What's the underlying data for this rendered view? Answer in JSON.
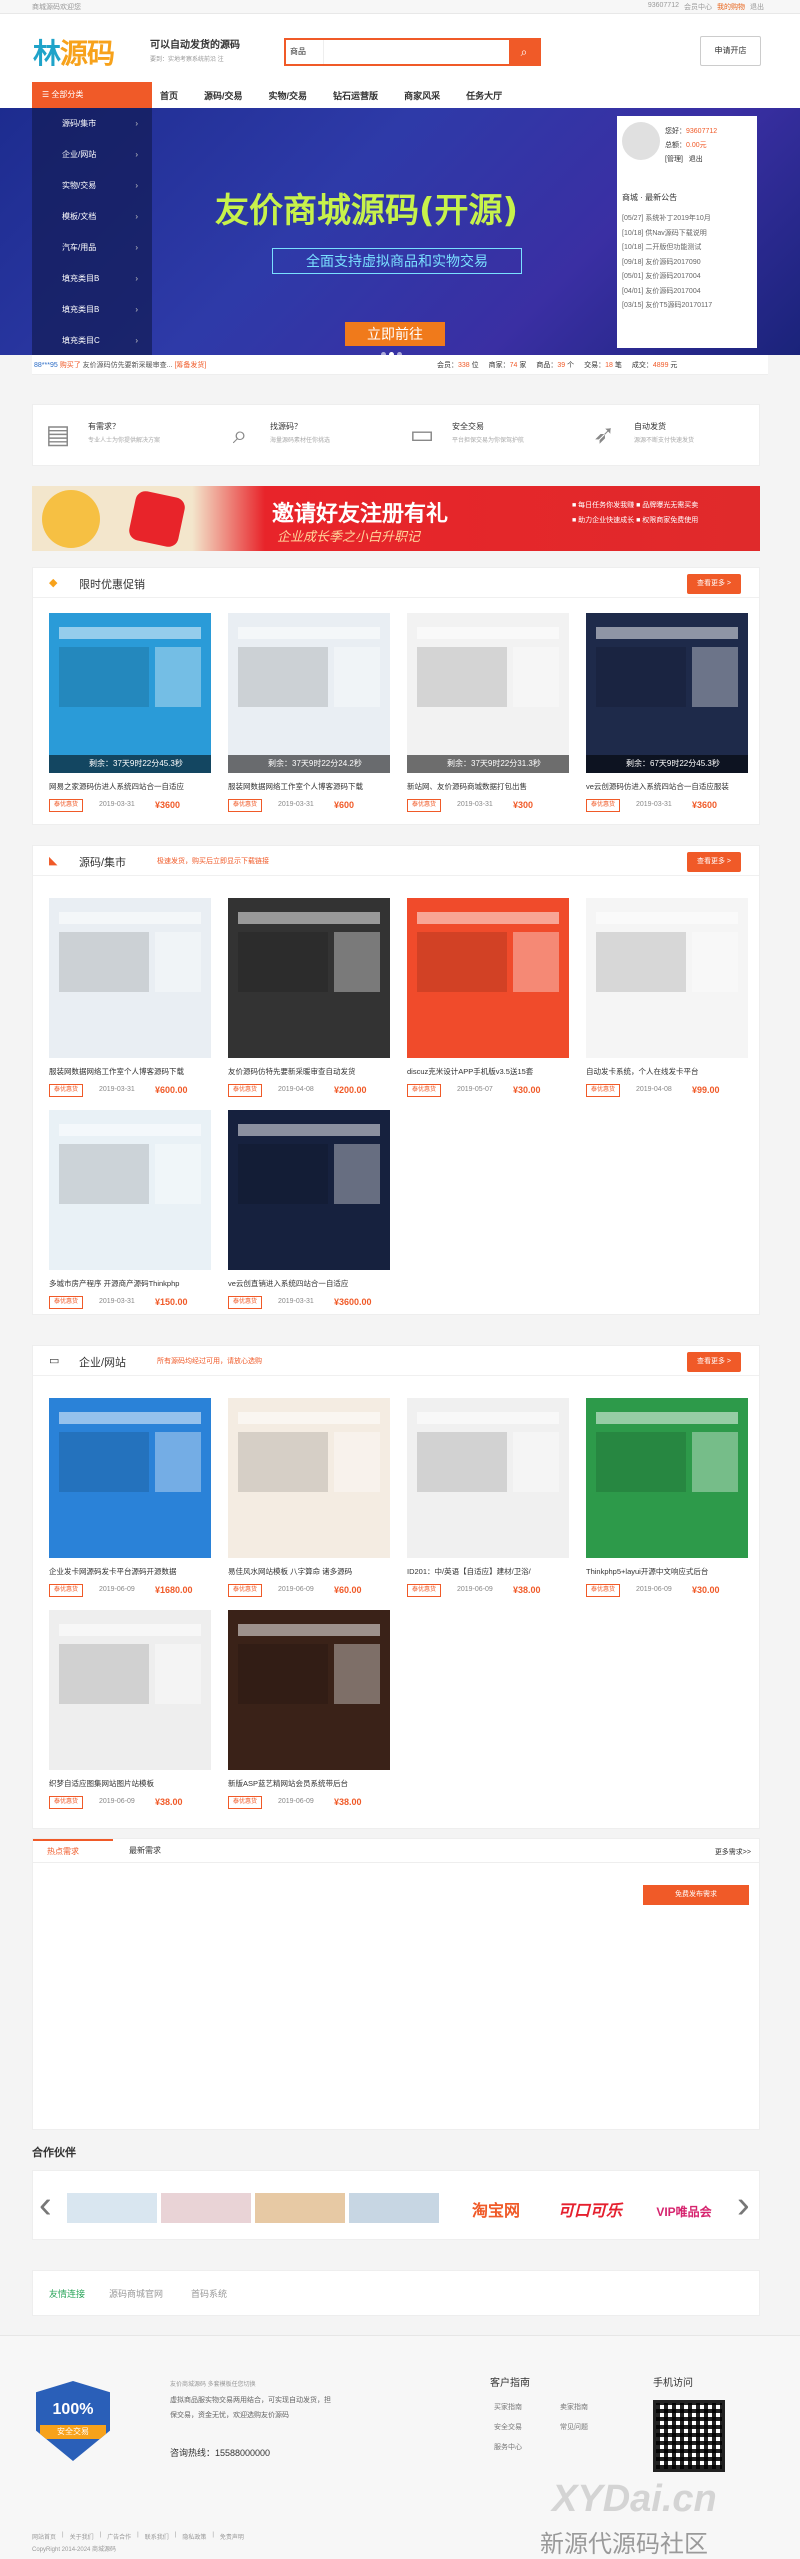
{
  "topbar": {
    "site": "商城源码欢迎您",
    "user": "93607712",
    "links": [
      "会员中心",
      "我的购物",
      "退出"
    ]
  },
  "header": {
    "logo_a": "林",
    "logo_b": "源码",
    "slogan": "可以自动发货的源码",
    "slogan2": "要到：实地考察系统前沿 注",
    "search_cat": "商品",
    "search_placeholder": "",
    "kaidian": "申请开店"
  },
  "nav": {
    "all": "全部分类",
    "items": [
      "首页",
      "源码/交易",
      "实物/交易",
      "钻石运营版",
      "商家风采",
      "任务大厅"
    ]
  },
  "side_cats": [
    "源码/集市",
    "企业/网站",
    "实物/交易",
    "模板/文档",
    "汽车/用品",
    "填充类目B",
    "填充类目B",
    "填充类目C"
  ],
  "banner": {
    "title": "友价商城源码(开源)",
    "sub": "全面支持虚拟商品和实物交易",
    "btn": "立即前往"
  },
  "userbox": {
    "greeting": "您好：",
    "uid": "93607712",
    "balance_label": "总额：",
    "balance": "0.00元",
    "manage": "[管理]",
    "logout": "退出",
    "notice_title": "商城 · 最新公告",
    "notices": [
      "[05/27] 系统补丁2019年10月",
      "[10/18] 供Nav源码下载说明",
      "[10/18] 二开版但功能测试",
      "[09/18] 友价源码2017090",
      "[05/01] 友价源码2017004",
      "[04/01] 友价源码2017004",
      "[03/15] 友价T5源码20170117"
    ]
  },
  "ticker": {
    "user": "88***95",
    "action": "购买了",
    "item": "友价源码仿先要新采暖审查...",
    "tag": "[筹备发货]",
    "stats": [
      {
        "label": "会员：",
        "val": "338",
        "unit": "位"
      },
      {
        "label": "商家：",
        "val": "74",
        "unit": "家"
      },
      {
        "label": "商品：",
        "val": "39",
        "unit": "个"
      },
      {
        "label": "交易：",
        "val": "18",
        "unit": "笔"
      },
      {
        "label": "成交：",
        "val": "4899",
        "unit": "元"
      }
    ]
  },
  "features": [
    {
      "icon": "document-icon",
      "title": "有需求？",
      "desc": "专业人士为你提供解决方案"
    },
    {
      "icon": "search-icon",
      "title": "找源码？",
      "desc": "海量源码素材任你挑选"
    },
    {
      "icon": "money-icon",
      "title": "安全交易",
      "desc": "平台担保交易为你保驾护航"
    },
    {
      "icon": "rocket-icon",
      "title": "自动发货",
      "desc": "源源不断支付快速发货"
    }
  ],
  "ad": {
    "title": "邀请好友注册有礼",
    "sub": "企业成长季之小白升职记",
    "r1": "■ 每日任务你发我赚  ■ 品牌曝光无需买卖",
    "r2": "■ 助力企业快速成长  ■ 权限商家免费使用"
  },
  "sections": [
    {
      "id": "promo",
      "title": "限时优惠促销",
      "sub": "",
      "more": "查看更多 >",
      "items": [
        {
          "name": "网易之家源码仿进人系统四站合一自适应",
          "tag": "泰优惠货",
          "date": "2019-03-31",
          "price": "¥3600",
          "countdown": "剩余：37天9时22分45.3秒",
          "color": "#2a9bd8"
        },
        {
          "name": "服装网数据网络工作室个人博客源码下载",
          "tag": "泰优惠货",
          "date": "2019-03-31",
          "price": "¥600",
          "countdown": "剩余：37天9时22分24.2秒",
          "color": "#e9eef3"
        },
        {
          "name": "新站网、友价源码商城数据打包出售",
          "tag": "泰优惠货",
          "date": "2019-03-31",
          "price": "¥300",
          "countdown": "剩余：37天9时22分31.3秒",
          "color": "#f2f2f2"
        },
        {
          "name": "ve云创源码仿进入系统四站合一自适应服装",
          "tag": "泰优惠货",
          "date": "2019-03-31",
          "price": "¥3600",
          "countdown": "剩余：67天9时22分45.3秒",
          "color": "#1e2a4a"
        }
      ]
    },
    {
      "id": "market",
      "title": "源码/集市",
      "sub": "极速发货，购买后立即显示下载链接",
      "more": "查看更多 >",
      "items": [
        {
          "name": "服装网数据网络工作室个人博客源码下载",
          "tag": "泰优惠货",
          "date": "2019-03-31",
          "price": "¥600.00",
          "color": "#e9eef3"
        },
        {
          "name": "友价源码仿特先要新采暖审查自动发货",
          "tag": "泰优惠货",
          "date": "2019-04-08",
          "price": "¥200.00",
          "color": "#333"
        },
        {
          "name": "discuz克米设计APP手机版v3.5送15套",
          "tag": "泰优惠货",
          "date": "2019-05-07",
          "price": "¥30.00",
          "color": "#f04b2b"
        },
        {
          "name": "自动发卡系统，个人在线发卡平台",
          "tag": "泰优惠货",
          "date": "2019-04-08",
          "price": "¥99.00",
          "color": "#f5f5f5"
        },
        {
          "name": "多城市房产程序 开源商产源码Thinkphp",
          "tag": "泰优惠货",
          "date": "2019-03-31",
          "price": "¥150.00",
          "color": "#e9f1f6"
        },
        {
          "name": "ve云创直销进入系统四站合一自适应",
          "tag": "泰优惠货",
          "date": "2019-03-31",
          "price": "¥3600.00",
          "color": "#16213e"
        }
      ]
    },
    {
      "id": "enterprise",
      "title": "企业/网站",
      "sub": "所有源码均经过可用，请放心选购",
      "more": "查看更多 >",
      "items": [
        {
          "name": "企业发卡网源码发卡平台源码开源数据",
          "tag": "泰优惠货",
          "date": "2019-06-09",
          "price": "¥1680.00",
          "color": "#2a82d8"
        },
        {
          "name": "易佳风水网站模板 八字算命 诸多源码",
          "tag": "泰优惠货",
          "date": "2019-06-09",
          "price": "¥60.00",
          "color": "#f4ece2"
        },
        {
          "name": "ID201：中/英语【自适应】建材/卫浴/",
          "tag": "泰优惠货",
          "date": "2019-06-09",
          "price": "¥38.00",
          "color": "#f0f0f0"
        },
        {
          "name": "Thinkphp5+layui开源中文响应式后台",
          "tag": "泰优惠货",
          "date": "2019-06-09",
          "price": "¥30.00",
          "color": "#2d9a4a"
        },
        {
          "name": "织梦自适应图集网站图片站模板",
          "tag": "泰优惠货",
          "date": "2019-06-09",
          "price": "¥38.00",
          "color": "#eee"
        },
        {
          "name": "新版ASP蓝艺精网站会员系统带后台",
          "tag": "泰优惠货",
          "date": "2019-06-09",
          "price": "¥38.00",
          "color": "#3a2218"
        }
      ]
    }
  ],
  "demand": {
    "tab1": "热点需求",
    "tab2": "最新需求",
    "more": "更多需求>>",
    "pub": "免费发布需求"
  },
  "partners": {
    "title": "合作伙伴",
    "logos": [
      "淘宝网",
      "可口可乐",
      "VIP唯品会"
    ]
  },
  "links": {
    "label": "友情连接",
    "items": [
      "源码商城官网",
      "首码系统"
    ]
  },
  "footer": {
    "badge_pct": "100%",
    "badge_txt": "安全交易",
    "text": [
      "友价商城源码 多套模板任您切换",
      "虚拟商品服实物交易两用结合，可实现自动发货，担",
      "保交易，资金无忧，欢迎选购友价源码"
    ],
    "phone": "咨询热线：15588000000",
    "guide_title": "客户指南",
    "guide": [
      "买家指南",
      "卖家指南",
      "安全交易",
      "常见问题",
      "服务中心"
    ],
    "mobile_title": "手机访问",
    "bottom": [
      "网站首页",
      "关于我们",
      "广告合作",
      "联系我们",
      "隐私政策",
      "免责声明"
    ],
    "copy": "CopyRight 2014-2024 商城源码",
    "wm1": "XYDai.cn",
    "wm2": "新源代源码社区"
  }
}
